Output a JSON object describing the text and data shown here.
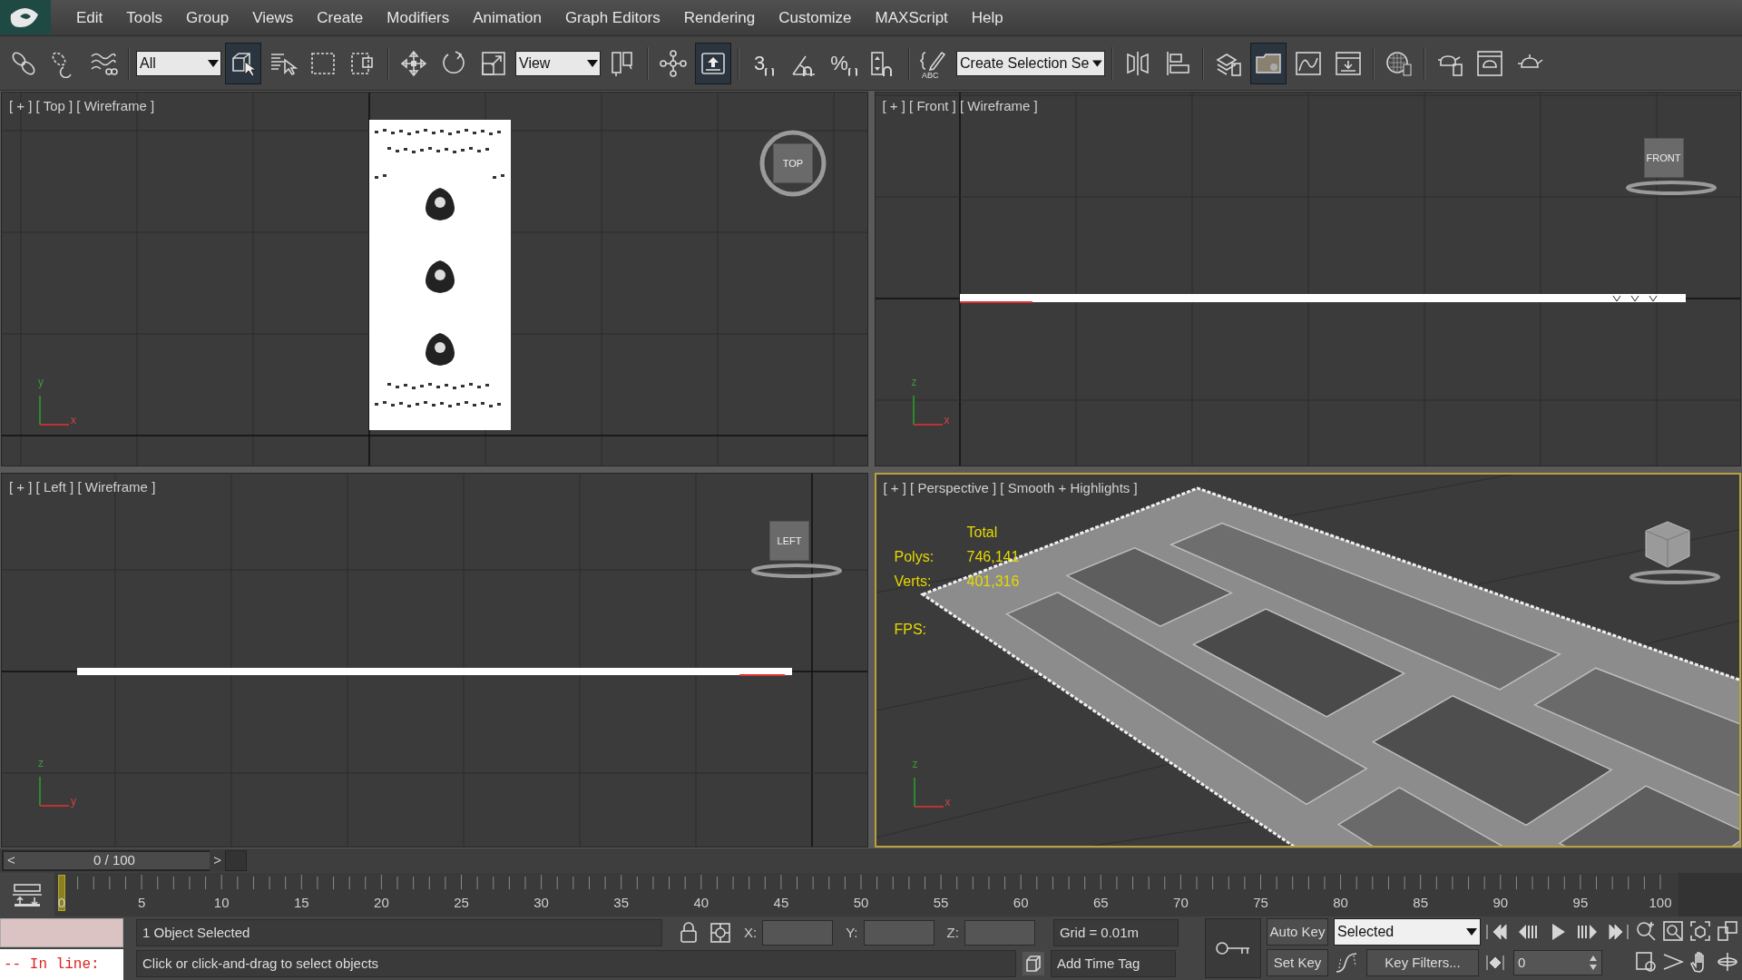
{
  "menu": [
    "Edit",
    "Tools",
    "Group",
    "Views",
    "Create",
    "Modifiers",
    "Animation",
    "Graph Editors",
    "Rendering",
    "Customize",
    "MAXScript",
    "Help"
  ],
  "toolbar": [
    [
      {
        "kind": "link",
        "selected": false
      },
      {
        "kind": "unlink",
        "selected": false
      },
      {
        "kind": "bind",
        "selected": false
      }
    ],
    [
      {
        "kind": "dropdown",
        "value": "All",
        "selected": false
      },
      {
        "kind": "select-object",
        "selected": true
      },
      {
        "kind": "select-by-name",
        "selected": false
      },
      {
        "kind": "rect-region",
        "selected": false
      },
      {
        "kind": "window-crossing",
        "selected": false
      }
    ],
    [
      {
        "kind": "move",
        "selected": false
      },
      {
        "kind": "rotate",
        "selected": false
      },
      {
        "kind": "scale",
        "selected": false
      },
      {
        "kind": "dropdown",
        "value": "View",
        "selected": false
      },
      {
        "kind": "pivot",
        "selected": false
      }
    ],
    [
      {
        "kind": "manipulate",
        "selected": false
      },
      {
        "kind": "keyboard-override",
        "selected": true
      }
    ],
    [
      {
        "kind": "snap",
        "glyph": "3",
        "selected": false
      },
      {
        "kind": "angle-snap",
        "selected": false
      },
      {
        "kind": "percent-snap",
        "glyph": "%",
        "selected": false
      },
      {
        "kind": "spinner-snap",
        "selected": false
      }
    ],
    [
      {
        "kind": "edit-named-selection",
        "glyph": "ABC",
        "selected": false
      },
      {
        "kind": "dropdown",
        "value": "Create Selection Se",
        "selected": false
      }
    ],
    [
      {
        "kind": "mirror",
        "selected": false
      },
      {
        "kind": "align",
        "selected": false
      }
    ],
    [
      {
        "kind": "layers",
        "selected": false
      },
      {
        "kind": "scene-explorer",
        "selected": true
      },
      {
        "kind": "curve-editor",
        "selected": false
      },
      {
        "kind": "schematic",
        "selected": false
      }
    ],
    [
      {
        "kind": "material-editor",
        "selected": false
      }
    ],
    [
      {
        "kind": "render-setup",
        "selected": false
      },
      {
        "kind": "rendered-frame",
        "selected": false
      },
      {
        "kind": "render",
        "selected": false
      }
    ]
  ],
  "viewports": [
    {
      "kind": "top",
      "label": "[ + ] [ Top ] [ Wireframe ]",
      "active": false,
      "cube": "TOP",
      "axes": [
        "y",
        "x"
      ]
    },
    {
      "kind": "front",
      "label": "[ + ] [ Front ] [ Wireframe ]",
      "active": false,
      "cube": "FRONT",
      "axes": [
        "z",
        "x"
      ]
    },
    {
      "kind": "left",
      "label": "[ + ] [ Left ] [ Wireframe ]",
      "active": false,
      "cube": "LEFT",
      "axes": [
        "z",
        "y"
      ]
    },
    {
      "kind": "perspective",
      "label": "[ + ] [ Perspective ] [ Smooth + Highlights ]",
      "active": true,
      "axes": [
        "z",
        "x"
      ],
      "stats": {
        "header": "Total",
        "rows": [
          {
            "label": "Polys:",
            "value": "746,141"
          },
          {
            "label": "Verts:",
            "value": "401,316"
          },
          {
            "label": "FPS:"
          }
        ]
      }
    }
  ],
  "time_slider": {
    "prev": "<",
    "position": "0 / 100",
    "next": ">"
  },
  "track_bar": {
    "ticks": [
      "0",
      "5",
      "10",
      "15",
      "20",
      "25",
      "30",
      "35",
      "40",
      "45",
      "50",
      "55",
      "60",
      "65",
      "70",
      "75",
      "80",
      "85",
      "90",
      "95",
      "100"
    ],
    "level": 0
  },
  "status": {
    "listener_prompt": "-- In line:",
    "selection": "1 Object Selected",
    "prompt": "Click or click-and-drag to select objects",
    "coords": [
      {
        "label": "X:"
      },
      {
        "label": "Y:"
      },
      {
        "label": "Z:"
      }
    ],
    "grid": "Grid = 0.01m",
    "time_tag": "Add Time Tag",
    "auto_key": "Auto Key",
    "key_mode": "Selected",
    "set_key": "Set Key",
    "key_filters": "Key Filters...",
    "frame": "0"
  }
}
